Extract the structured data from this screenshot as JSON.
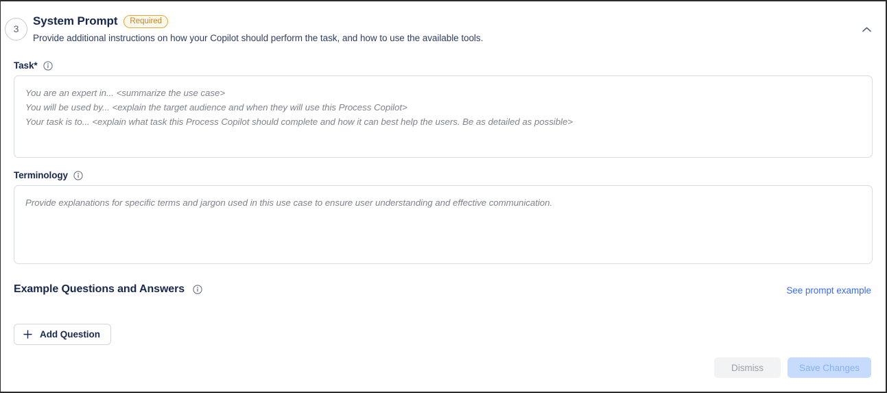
{
  "section": {
    "step_number": "3",
    "title": "System Prompt",
    "badge": "Required",
    "subtitle": "Provide additional instructions on how your Copilot should perform the task, and how to use the available tools.",
    "collapse_icon": "chevron-up-icon",
    "accent_link_color": "#3b6bf5",
    "badge_border_color": "#e0a93a",
    "title_color": "#17274d"
  },
  "task_field": {
    "label": "Task*",
    "info_icon": "info-icon",
    "value": "",
    "placeholder_lines": [
      "You are an expert in... <summarize the use case>",
      "You will be used by... <explain the target audience and when they will use this Process Copilot>",
      "Your task is to... <explain what task this Process Copilot should complete and how it can best help the users. Be as detailed as possible>"
    ]
  },
  "terminology_field": {
    "label": "Terminology",
    "info_icon": "info-icon",
    "value": "",
    "placeholder_lines": [
      "Provide explanations for specific terms and jargon used in this use case to ensure user understanding and effective communication."
    ]
  },
  "examples": {
    "title": "Example Questions and Answers",
    "info_icon": "info-icon",
    "link_label": "See prompt example",
    "add_button_label": "Add Question",
    "add_button_icon": "plus-icon"
  },
  "footer": {
    "dismiss_label": "Dismiss",
    "save_label": "Save Changes",
    "dismiss_disabled": "true",
    "save_disabled": "true"
  }
}
